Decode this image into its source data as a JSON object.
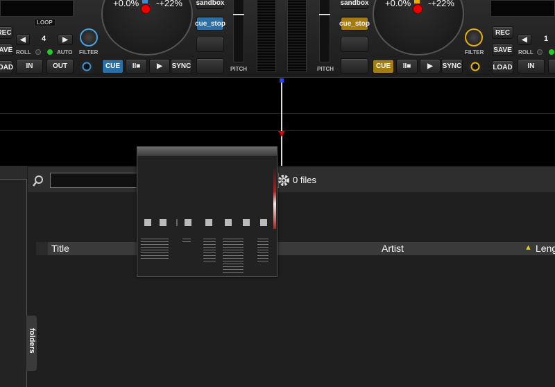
{
  "left_deck": {
    "pitch_value": "+0.0%",
    "pitch_range": "-+22%",
    "loop_label": "LOOP",
    "loop_size": "4",
    "roll_label": "ROLL",
    "auto_label": "AUTO",
    "in_label": "IN",
    "out_label": "OUT",
    "filter_label": "FILTER",
    "rec_label": "REC",
    "save_label": "SAVE",
    "load_label": "LOAD",
    "cue_label": "CUE",
    "play_pause_label": "II■",
    "play_label": "▶",
    "sync_label": "SYNC",
    "sandbox_label": "sandbox",
    "cue_stop_label": "cue_stop",
    "pitch_label": "PITCH",
    "accent": "#3a8fd0"
  },
  "right_deck": {
    "pitch_value": "+0.0%",
    "pitch_range": "-+22%",
    "loop_size": "1",
    "roll_label": "ROLL",
    "filter_label": "FILTER",
    "rec_label": "REC",
    "save_label": "SAVE",
    "load_label": "LOAD",
    "in_label": "IN",
    "cue_label": "CUE",
    "play_pause_label": "II■",
    "play_label": "▶",
    "sync_label": "SYNC",
    "sandbox_label": "sandbox",
    "cue_stop_label": "cue_stop",
    "pitch_label": "PITCH",
    "accent": "#c89a10"
  },
  "browser": {
    "search_placeholder": "",
    "file_count": "0 files",
    "columns": [
      "Title",
      "Artist",
      "Leng"
    ],
    "sort_indicator": "▲",
    "folders_tab": "folders"
  },
  "icons": {
    "search": "search-icon",
    "settings": "gear-icon"
  }
}
